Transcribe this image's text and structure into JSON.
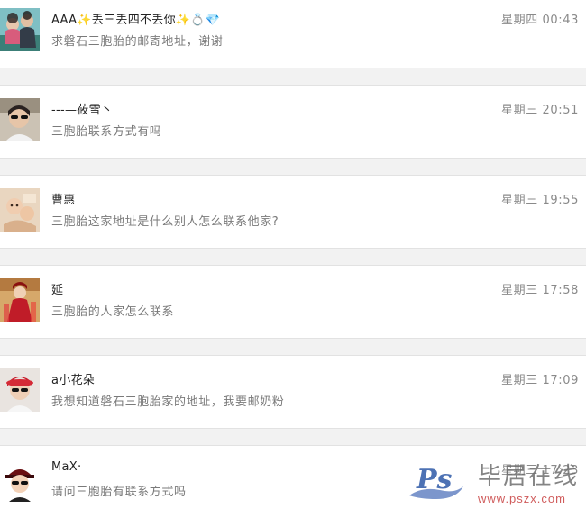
{
  "conversations": [
    {
      "name": "AAA✨丢三丢四不丢你✨💍💎",
      "time": "星期四  00:43",
      "message": "求磐石三胞胎的邮寄地址，谢谢",
      "avatar_icon": "avatar-family-photo"
    },
    {
      "name": "---—莜雪丶",
      "time": "星期三  20:51",
      "message": "三胞胎联系方式有吗",
      "avatar_icon": "avatar-sunglasses-person"
    },
    {
      "name": "曹惠",
      "time": "星期三  19:55",
      "message": "三胞胎这家地址是什么别人怎么联系他家?",
      "avatar_icon": "avatar-baby-photo"
    },
    {
      "name": "延",
      "time": "星期三  17:58",
      "message": "三胞胎的人家怎么联系",
      "avatar_icon": "avatar-red-costume"
    },
    {
      "name": "a小花朵",
      "time": "星期三  17:09",
      "message": "我想知道磐石三胞胎家的地址，我要邮奶粉",
      "avatar_icon": "avatar-red-hat-woman"
    },
    {
      "name": "MaX·",
      "time": "星期三  17:23",
      "message": "请问三胞胎有联系方式吗",
      "avatar_icon": "avatar-cartoon-character"
    }
  ],
  "watermark": {
    "site_name": "毕居在线",
    "url": "www.pszx.com",
    "logo_icon": "ps-logo-icon"
  },
  "colors": {
    "separator": "#f2f2f2",
    "name_text": "#222222",
    "meta_text": "#8a8a8a",
    "message_text": "#7a7a7a"
  }
}
